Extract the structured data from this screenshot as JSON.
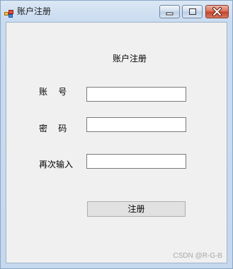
{
  "window": {
    "title": "账户注册",
    "icons": {
      "app": "app-window-icon",
      "minimize": "minimize-icon",
      "maximize": "maximize-icon",
      "close": "close-icon"
    },
    "colors": {
      "close_button": "#c0432a",
      "client_background": "#f0f0f0"
    }
  },
  "form": {
    "heading": "账户注册",
    "account_label": "账    号",
    "password_label": "密    码",
    "repeat_label": "再次输入",
    "account_value": "",
    "password_value": "",
    "repeat_value": "",
    "submit_label": "注册"
  },
  "watermark": "CSDN @R-G-B"
}
